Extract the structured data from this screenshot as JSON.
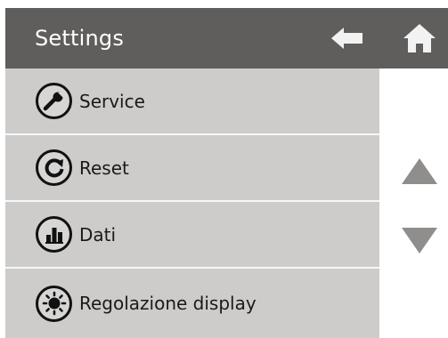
{
  "header": {
    "title": "Settings",
    "back_icon": "back-arrow-icon",
    "home_icon": "home-icon"
  },
  "menu": {
    "items": [
      {
        "label": "Service",
        "icon": "wrench-icon"
      },
      {
        "label": "Reset",
        "icon": "reset-icon"
      },
      {
        "label": "Dati",
        "icon": "bar-chart-icon"
      },
      {
        "label": "Regolazione display",
        "icon": "brightness-icon"
      }
    ]
  },
  "scroll": {
    "up_icon": "scroll-up-icon",
    "down_icon": "scroll-down-icon"
  },
  "colors": {
    "header_bg": "#5f5e5c",
    "item_bg": "#cdcccb",
    "arrow": "#8f8e8c"
  }
}
